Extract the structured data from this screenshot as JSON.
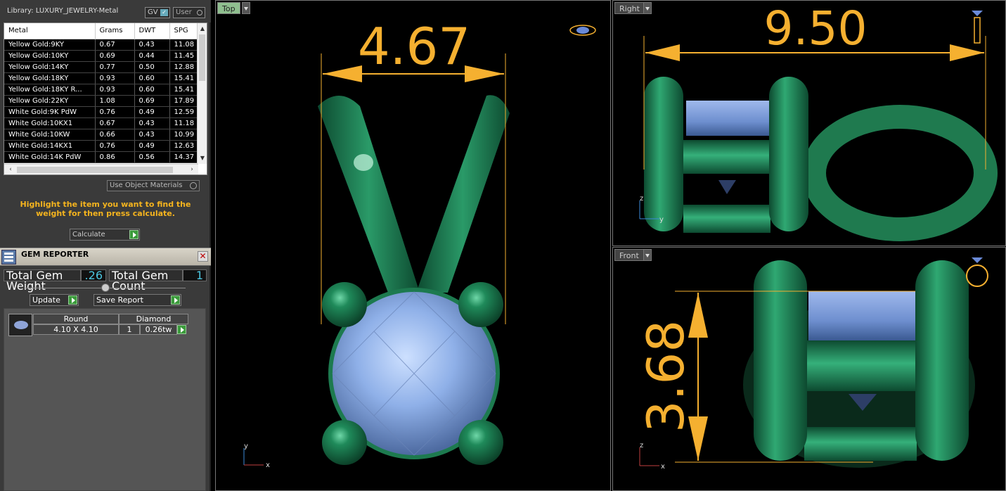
{
  "library": {
    "title": "Library: LUXURY_JEWELRY-Metal",
    "gv_label": "GV",
    "user_label": "User"
  },
  "metal_table": {
    "headers": [
      "Metal",
      "Grams",
      "DWT",
      "SPG"
    ],
    "rows": [
      [
        "Yellow Gold:9KY",
        "0.67",
        "0.43",
        "11.08"
      ],
      [
        "Yellow Gold:10KY",
        "0.69",
        "0.44",
        "11.45"
      ],
      [
        "Yellow Gold:14KY",
        "0.77",
        "0.50",
        "12.88"
      ],
      [
        "Yellow Gold:18KY",
        "0.93",
        "0.60",
        "15.41"
      ],
      [
        "Yellow Gold:18KY R...",
        "0.93",
        "0.60",
        "15.41"
      ],
      [
        "Yellow Gold:22KY",
        "1.08",
        "0.69",
        "17.89"
      ],
      [
        "White Gold:9K PdW",
        "0.76",
        "0.49",
        "12.59"
      ],
      [
        "White Gold:10KX1",
        "0.67",
        "0.43",
        "11.18"
      ],
      [
        "White Gold:10KW",
        "0.66",
        "0.43",
        "10.99"
      ],
      [
        "White Gold:14KX1",
        "0.76",
        "0.49",
        "12.63"
      ],
      [
        "White Gold:14K PdW",
        "0.86",
        "0.56",
        "14.37"
      ]
    ]
  },
  "use_object_materials": "Use Object Materials",
  "hint": "Highlight the item you want to find the weight for then press calculate.",
  "calculate_label": "Calculate",
  "gem_reporter": {
    "title": "GEM REPORTER",
    "total_weight_label": "Total Gem Weight",
    "total_weight_value": ".26",
    "total_count_label": "Total Gem Count",
    "total_count_value": "1",
    "update_label": "Update",
    "save_report_label": "Save Report",
    "gem": {
      "shape": "Round",
      "type": "Diamond",
      "size": "4.10 X 4.10",
      "count": "1",
      "weight": "0.26tw"
    }
  },
  "viewports": {
    "top": {
      "label": "Top",
      "dimension": "4.67",
      "axis_x": "x",
      "axis_y": "y"
    },
    "right": {
      "label": "Right",
      "dimension": "9.50",
      "axis_x": "y",
      "axis_y": "z"
    },
    "front": {
      "label": "Front",
      "dimension": "3.68",
      "axis_x": "x",
      "axis_y": "z"
    }
  },
  "colors": {
    "metal_green": "#1f7a4f",
    "dimension_orange": "#f5b030",
    "gem_blue": "#8fb0e8",
    "hint_yellow": "#f5b41e"
  }
}
